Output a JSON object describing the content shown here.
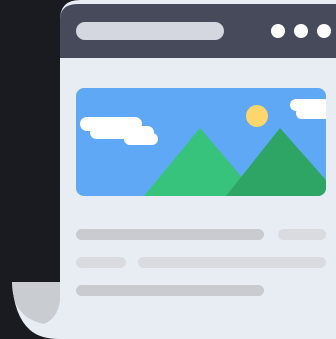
{
  "illustration": {
    "icon": "web-page-document-icon",
    "window_controls": {
      "dots_count": 3
    },
    "colors": {
      "background": "#1a1a21",
      "title_bar": "#474a5a",
      "address_pill": "#d4d7df",
      "dots": "#ffffff",
      "page": "#e8edf4",
      "page_curl_shadow": "#c9ccd1",
      "sky": "#5ea8f6",
      "sun": "#ffd66b",
      "clouds": "#ffffff",
      "mountain_left": "#37c37b",
      "mountain_right": "#2ea565",
      "text_line": "#c9cbd0",
      "text_line_light": "#d9dbe0"
    }
  }
}
